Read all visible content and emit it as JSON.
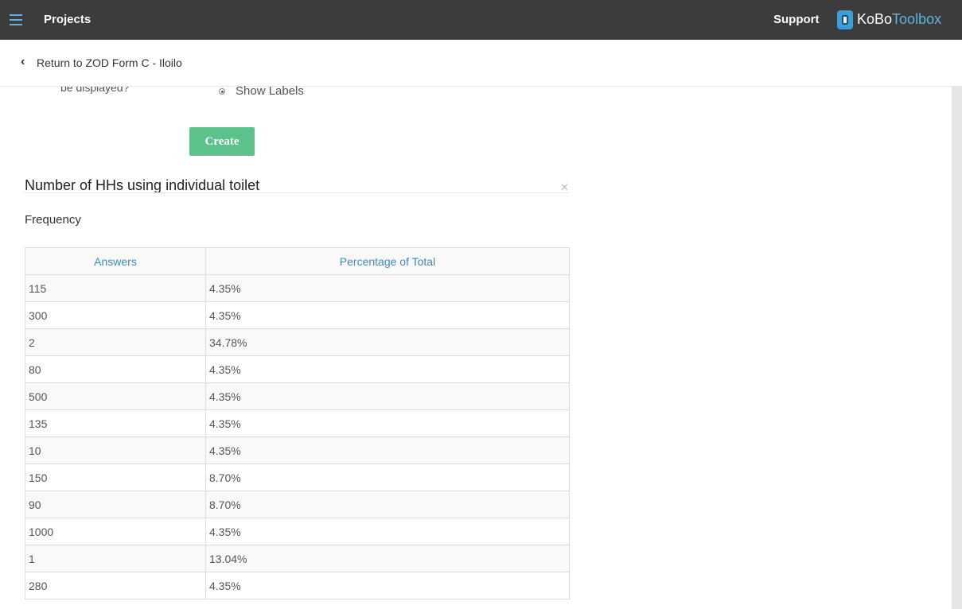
{
  "topbar": {
    "title": "Projects",
    "support_label": "Support",
    "brand_part1": "KoBo",
    "brand_part2": "Toolbox"
  },
  "subheader": {
    "back_link": "Return to ZOD Form C - Iloilo"
  },
  "form": {
    "partial_label": "be displayed?",
    "radio_option": "Show Labels",
    "create_button": "Create"
  },
  "report": {
    "title": "Number of HHs using individual toilet",
    "subtitle": "Frequency",
    "columns": [
      "Answers",
      "Percentage of Total"
    ],
    "rows": [
      [
        "115",
        "4.35%"
      ],
      [
        "300",
        "4.35%"
      ],
      [
        "2",
        "34.78%"
      ],
      [
        "80",
        "4.35%"
      ],
      [
        "500",
        "4.35%"
      ],
      [
        "135",
        "4.35%"
      ],
      [
        "10",
        "4.35%"
      ],
      [
        "150",
        "8.70%"
      ],
      [
        "90",
        "8.70%"
      ],
      [
        "1000",
        "4.35%"
      ],
      [
        "1",
        "13.04%"
      ],
      [
        "280",
        "4.35%"
      ]
    ]
  },
  "colors": {
    "topbar_bg": "#3c3c3c",
    "accent_blue": "#5fb3d9",
    "create_green": "#5cc18b",
    "header_text_blue": "#3a8dbf"
  }
}
